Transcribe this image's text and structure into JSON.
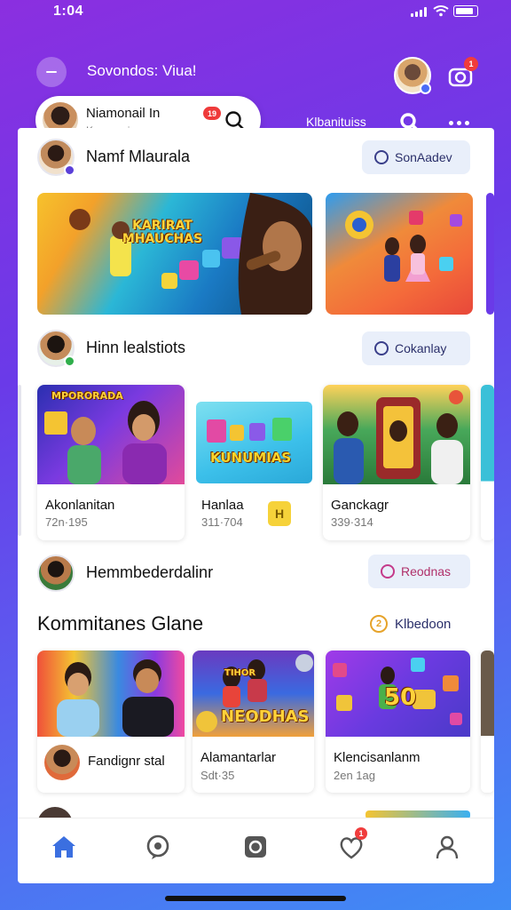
{
  "status_bar": {
    "time": "1:04"
  },
  "app_bar": {
    "title": "Sovondos: Viua!",
    "notification_badge": "1",
    "profile": {
      "name": "Niamonail In",
      "badge": "19",
      "subtitle": "Kwomoniuacoom"
    },
    "link": "Klbanituiss"
  },
  "rows": [
    {
      "title": "Namf Mlaurala",
      "action": "SonAadev"
    },
    {
      "title": "Hinn lealstiots",
      "action": "Cokanlay"
    },
    {
      "title": "Hemmbederdalinr",
      "action": "Reodnas"
    }
  ],
  "banners": [
    {
      "text": "KARIRAT MHAUCHAS"
    }
  ],
  "cards_row_1": [
    {
      "title": "Akonlanitan",
      "meta": "72n·195",
      "thumb_text": "MPORORADA"
    },
    {
      "title": "Hanlaa",
      "meta": "311·704",
      "thumb_text": "KUNUMIAS"
    },
    {
      "title": "Ganckagr",
      "meta": "339·314"
    }
  ],
  "section": {
    "title": "Kommitanes Glane",
    "link": "Klbedoon",
    "link_icon_text": "2"
  },
  "cards_row_2": [
    {
      "title": "Fandignr stal"
    },
    {
      "title": "Alamantarlar",
      "meta": "Sdt·35",
      "thumb_text": "NEODHAS",
      "thumb_top_text": "TIHOR"
    },
    {
      "title": "Klencisanlanm",
      "meta": "2en 1ag",
      "thumb_text": "50"
    }
  ],
  "colors": {
    "accent": "#3b6fe0",
    "badge": "#f03c3c",
    "gradient_start": "#8b2fe0",
    "gradient_end": "#3f8cf5"
  },
  "tabbar": {
    "items": [
      "home-icon",
      "chat-icon",
      "message-icon",
      "heart-icon",
      "profile-icon"
    ],
    "heart_badge": "1"
  }
}
